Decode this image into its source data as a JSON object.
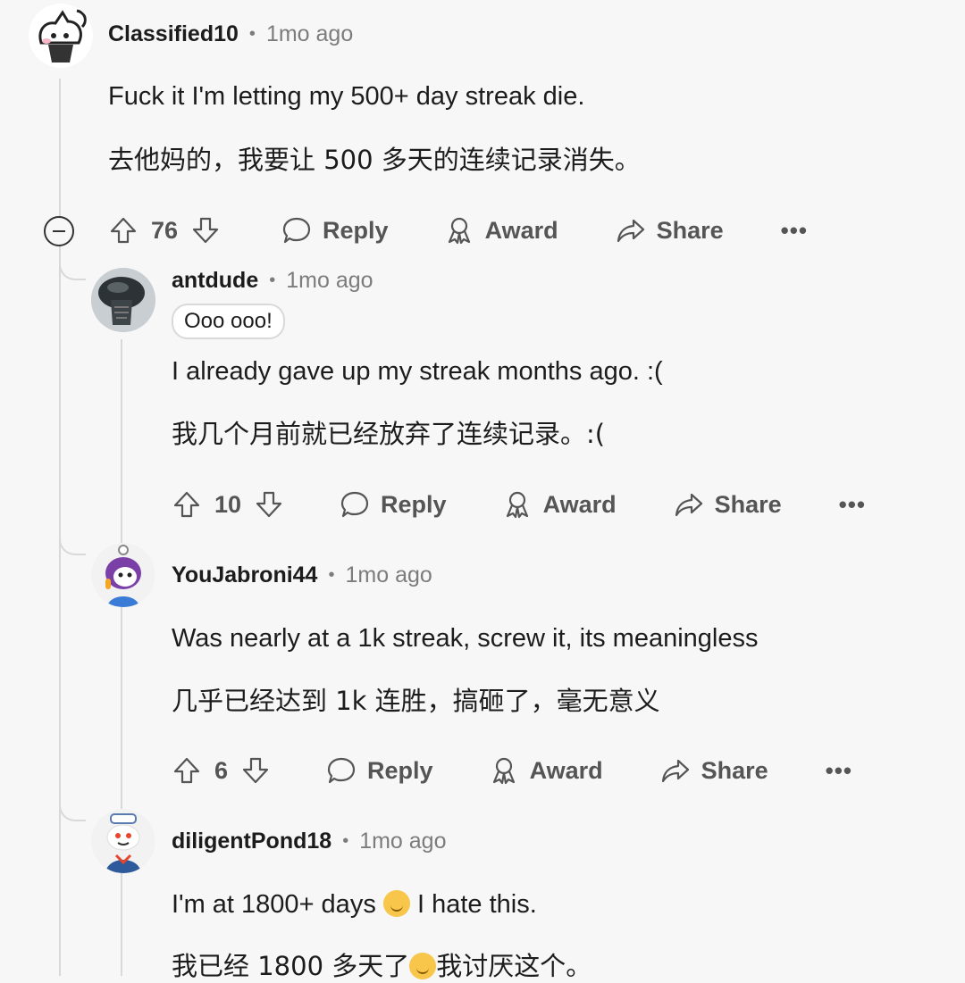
{
  "comments": [
    {
      "username": "Classified10",
      "separator": "•",
      "time": "1mo ago",
      "text_en": "Fuck it I'm letting my 500+ day streak die.",
      "text_zh": "去他妈的，我要让 500 多天的连续记录消失。",
      "votes": "76",
      "reply": "Reply",
      "award": "Award",
      "share": "Share",
      "more": "•••",
      "avatar": "skull-cat-avatar"
    },
    {
      "username": "antdude",
      "separator": "•",
      "time": "1mo ago",
      "flair": "Ooo ooo!",
      "text_en": "I already gave up my streak months ago. :(",
      "text_zh": "我几个月前就已经放弃了连续记录。:(",
      "votes": "10",
      "reply": "Reply",
      "award": "Award",
      "share": "Share",
      "more": "•••",
      "avatar": "alien-avatar"
    },
    {
      "username": "YouJabroni44",
      "separator": "•",
      "time": "1mo ago",
      "text_en": "Was nearly at a 1k streak, screw it, its meaningless",
      "text_zh": "几乎已经达到 1k 连胜，搞砸了，毫无意义",
      "votes": "6",
      "reply": "Reply",
      "award": "Award",
      "share": "Share",
      "more": "•••",
      "avatar": "purple-hair-avatar"
    },
    {
      "username": "diligentPond18",
      "separator": "•",
      "time": "1mo ago",
      "text_en_a": "I'm at 1800+ days",
      "text_en_b": "I hate this.",
      "text_zh_a": "我已经 1800 多天了",
      "text_zh_b": "我讨厌这个。",
      "emoji": "smiling-face-emoji",
      "avatar": "sailor-snoo-avatar"
    }
  ]
}
